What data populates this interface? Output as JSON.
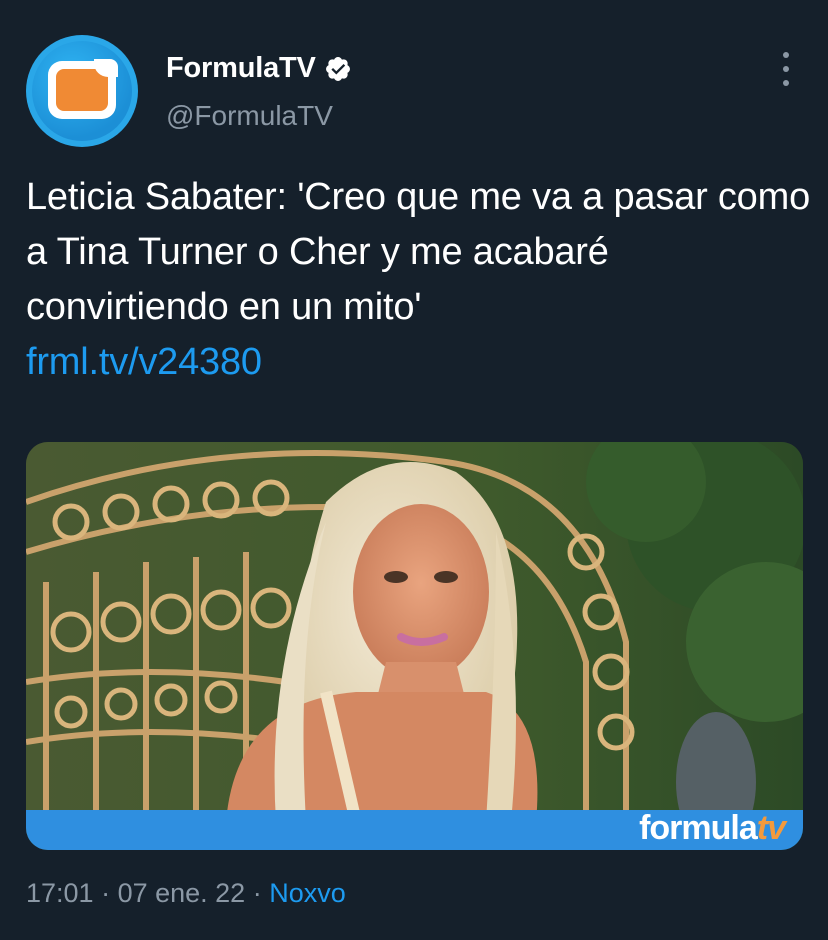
{
  "account": {
    "name": "FormulaTV",
    "handle": "@FormulaTV",
    "verified": true,
    "avatar_icon": "formulatv-logo-icon"
  },
  "tweet": {
    "text": "Leticia Sabater: 'Creo que me va a pasar como a Tina Turner o Cher y me acabaré convirtiendo en un mito'",
    "link": "frml.tv/v24380"
  },
  "card": {
    "brand_main": "formula",
    "brand_suffix": "tv"
  },
  "meta": {
    "time": "17:01",
    "separator1": " · ",
    "date": "07 ene. 22",
    "separator2": " · ",
    "source": "Noxvo"
  },
  "colors": {
    "background": "#15202b",
    "link": "#1d9bf0",
    "secondary_text": "#8b98a5",
    "brand_orange": "#f08a34",
    "card_bar": "#2f8fe0"
  }
}
